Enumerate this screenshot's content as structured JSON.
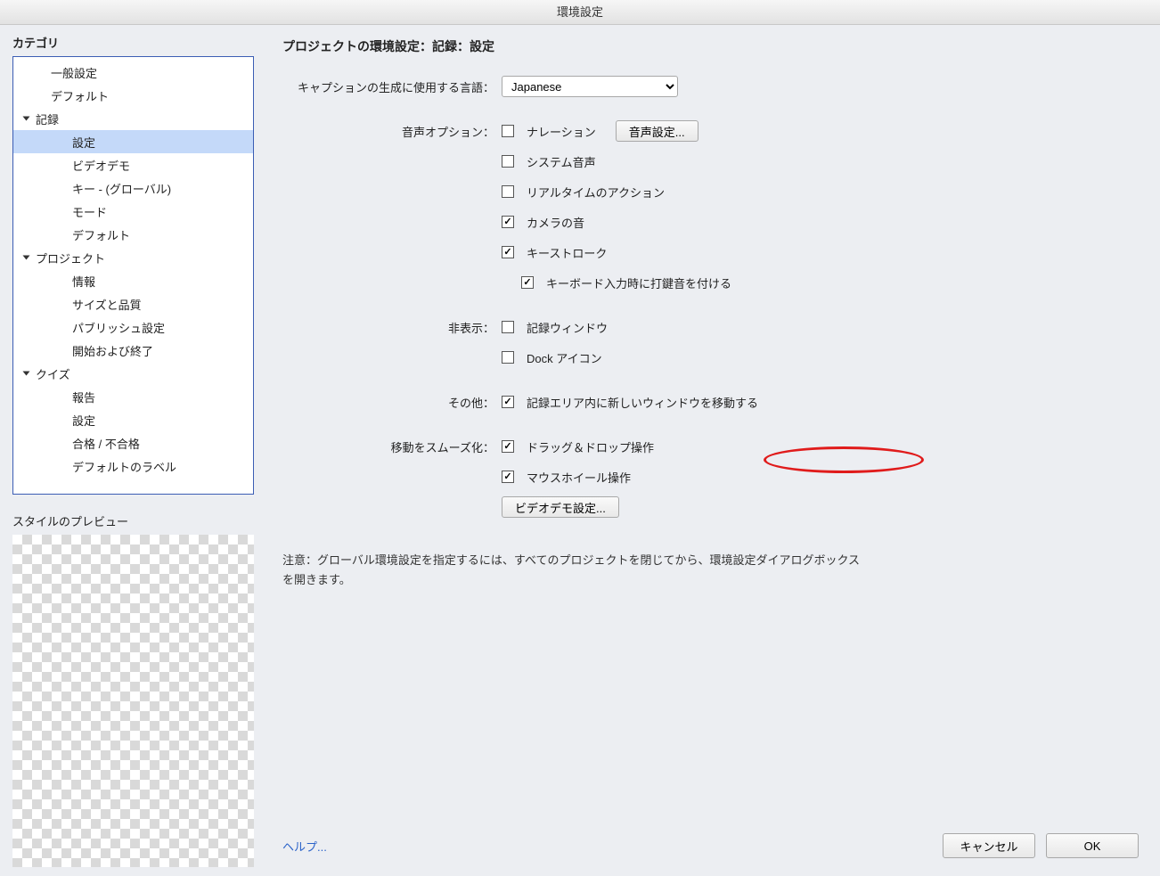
{
  "window_title": "環境設定",
  "left": {
    "category_label": "カテゴリ",
    "preview_label": "スタイルのプレビュー",
    "tree": {
      "general": "一般設定",
      "defaults1": "デフォルト",
      "recording": "記録",
      "rec_settings": "設定",
      "rec_video": "ビデオデモ",
      "rec_keys": "キー - (グローバル)",
      "rec_mode": "モード",
      "rec_defaults": "デフォルト",
      "project": "プロジェクト",
      "proj_info": "情報",
      "proj_size": "サイズと品質",
      "proj_publish": "パブリッシュ設定",
      "proj_start": "開始および終了",
      "quiz": "クイズ",
      "quiz_report": "報告",
      "quiz_settings": "設定",
      "quiz_pass": "合格 / 不合格",
      "quiz_labels": "デフォルトのラベル"
    }
  },
  "main": {
    "heading": "プロジェクトの環境設定：記録：設定",
    "caption_lang_label": "キャプションの生成に使用する言語：",
    "caption_lang_value": "Japanese",
    "audio_label": "音声オプション：",
    "audio": {
      "narration": "ナレーション",
      "audio_settings_btn": "音声設定...",
      "system": "システム音声",
      "realtime": "リアルタイムのアクション",
      "camera": "カメラの音",
      "keystroke": "キーストローク",
      "type_sound": "キーボード入力時に打鍵音を付ける"
    },
    "hide_label": "非表示：",
    "hide": {
      "rec_window": "記録ウィンドウ",
      "dock_icon": "Dock アイコン"
    },
    "other_label": "その他：",
    "other": {
      "move_window": "記録エリア内に新しいウィンドウを移動する"
    },
    "smooth_label": "移動をスムーズ化：",
    "smooth": {
      "drag": "ドラッグ＆ドロップ操作",
      "wheel": "マウスホイール操作"
    },
    "video_demo_btn": "ビデオデモ設定...",
    "note": "注意：グローバル環境設定を指定するには、すべてのプロジェクトを閉じてから、環境設定ダイアログボックスを開きます。",
    "help": "ヘルプ...",
    "cancel": "キャンセル",
    "ok": "OK"
  }
}
